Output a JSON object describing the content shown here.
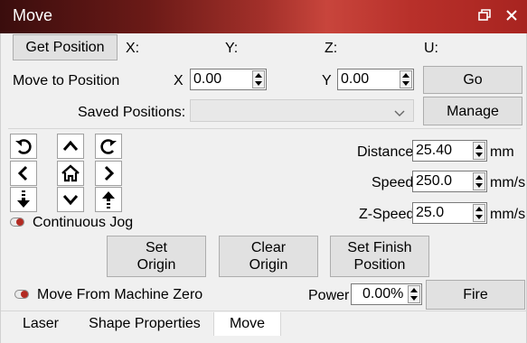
{
  "window": {
    "title": "Move",
    "restore_icon": "restore-window-icon",
    "close_icon": "close-icon"
  },
  "position": {
    "get_button": "Get Position",
    "x_label": "X:",
    "y_label": "Y:",
    "z_label": "Z:",
    "u_label": "U:"
  },
  "move_to": {
    "label": "Move to Position",
    "x_label": "X",
    "x_value": "0.00",
    "y_label": "Y",
    "y_value": "0.00",
    "go_button": "Go"
  },
  "saved": {
    "label": "Saved Positions:",
    "selected": "",
    "manage_button": "Manage"
  },
  "jog": {
    "buttons": [
      "rotate-ccw-icon",
      "arrow-up-icon",
      "rotate-cw-icon",
      "arrow-left-icon",
      "home-icon",
      "arrow-right-icon",
      "z-down-icon",
      "arrow-down-icon",
      "z-up-icon"
    ]
  },
  "params": {
    "distance_label": "Distance",
    "distance_value": "25.40",
    "distance_unit": "mm",
    "speed_label": "Speed",
    "speed_value": "250.0",
    "speed_unit": "mm/s",
    "zspeed_label": "Z-Speed",
    "zspeed_value": "25.0",
    "zspeed_unit": "mm/s"
  },
  "continuous_jog": {
    "label": "Continuous Jog",
    "on": true
  },
  "actions": {
    "set_origin": "Set\nOrigin",
    "clear_origin": "Clear\nOrigin",
    "set_finish": "Set Finish\nPosition"
  },
  "bottom": {
    "machine_zero_label": "Move From Machine Zero",
    "machine_zero_on": true,
    "power_label": "Power",
    "power_value": "0.00%",
    "fire_button": "Fire"
  },
  "tabs": [
    {
      "label": "Laser",
      "active": false
    },
    {
      "label": "Shape Properties",
      "active": false
    },
    {
      "label": "Move",
      "active": true
    }
  ],
  "colors": {
    "accent": "#b22a22",
    "title_text": "#ffffff"
  }
}
